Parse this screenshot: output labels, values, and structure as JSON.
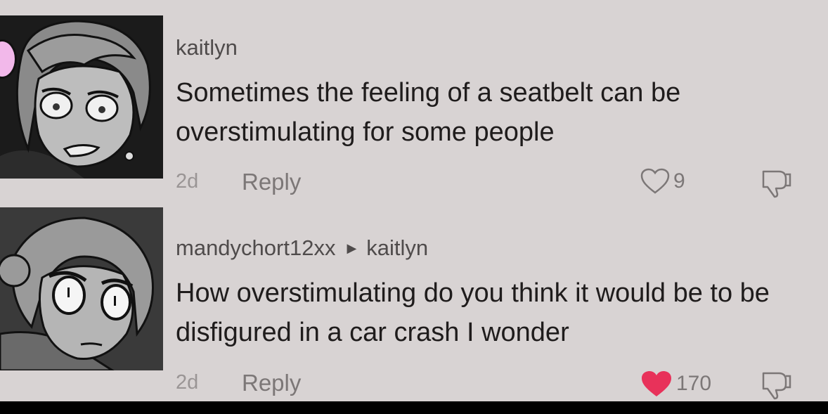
{
  "comments": [
    {
      "username": "kaitlyn",
      "text": "Sometimes the feeling of a seatbelt can be overstimulating for some people",
      "time": "2d",
      "reply_label": "Reply",
      "likes": "9",
      "liked": false
    },
    {
      "username": "mandychort12xx",
      "reply_to": "kaitlyn",
      "text": "How overstimulating do you think it would be to be disfigured in a car crash I wonder",
      "time": "2d",
      "reply_label": "Reply",
      "likes": "170",
      "liked": true
    }
  ],
  "colors": {
    "background": "#d8d3d3",
    "liked_heart": "#e8325a",
    "text": "#1f1c1c",
    "muted": "#7c7777"
  }
}
